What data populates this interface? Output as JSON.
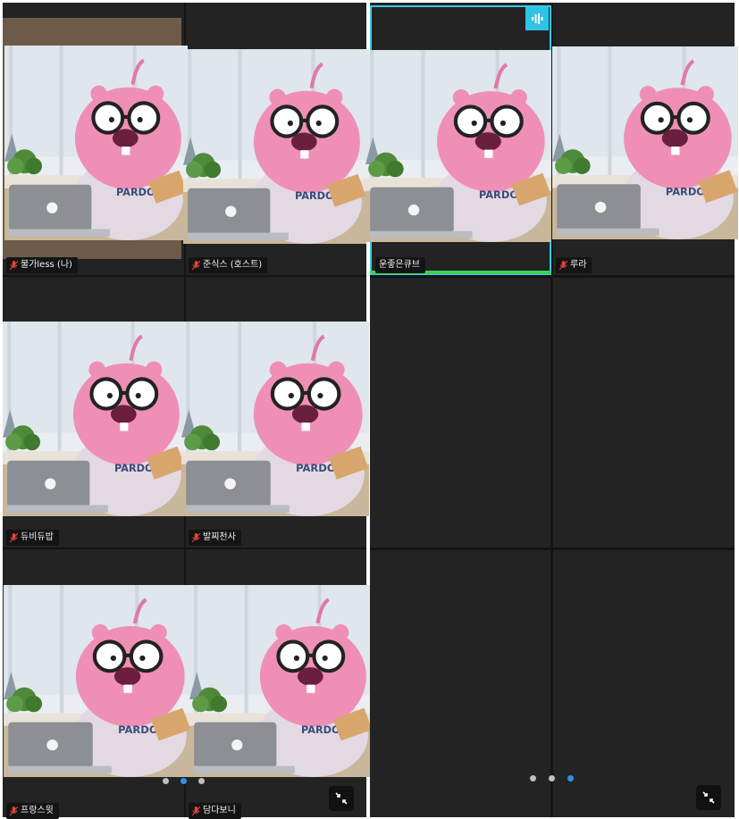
{
  "colors": {
    "tile_bg": "#242424",
    "name_bg": "#141414",
    "active_speaker_border": "#35c9e8",
    "active_speaker_bottom": "#3ad15a",
    "muted_mic": "#e0443e",
    "page_dot_active": "#2f8ff0",
    "page_dot": "#bfbfbf"
  },
  "left_screen": {
    "participants": [
      {
        "name": "불가less (나)",
        "muted": true
      },
      {
        "name": "준식스 (호스트)",
        "muted": true
      },
      {
        "name": "듀비듀밥",
        "muted": true
      },
      {
        "name": "발찌천사",
        "muted": true
      },
      {
        "name": "프랑스윗",
        "muted": true
      },
      {
        "name": "담다보니",
        "muted": true
      }
    ],
    "page_dots": {
      "count": 3,
      "active": 2
    },
    "minimize_icon": "minimize-icon"
  },
  "right_screen": {
    "participants": [
      {
        "name": "운좋은큐브",
        "muted": false,
        "speaking": true
      },
      {
        "name": "루라",
        "muted": true
      }
    ],
    "speaking_icon": "audio-wave-icon",
    "page_dots": {
      "count": 3,
      "active": 3
    },
    "minimize_icon": "minimize-icon"
  }
}
